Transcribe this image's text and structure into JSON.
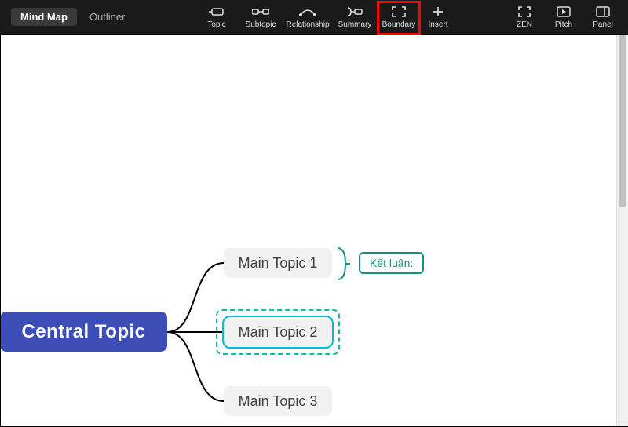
{
  "toolbar": {
    "views": {
      "mindmap": "Mind Map",
      "outliner": "Outliner"
    },
    "tools": {
      "topic": "Topic",
      "subtopic": "Subtopic",
      "relationship": "Relationship",
      "summary": "Summary",
      "boundary": "Boundary",
      "insert": "Insert",
      "zen": "ZEN",
      "pitch": "Pitch",
      "panel": "Panel"
    }
  },
  "mindmap": {
    "central": "Central Topic",
    "topics": [
      "Main Topic 1",
      "Main Topic 2",
      "Main Topic 3"
    ],
    "summary_label": "Kết luận:"
  }
}
